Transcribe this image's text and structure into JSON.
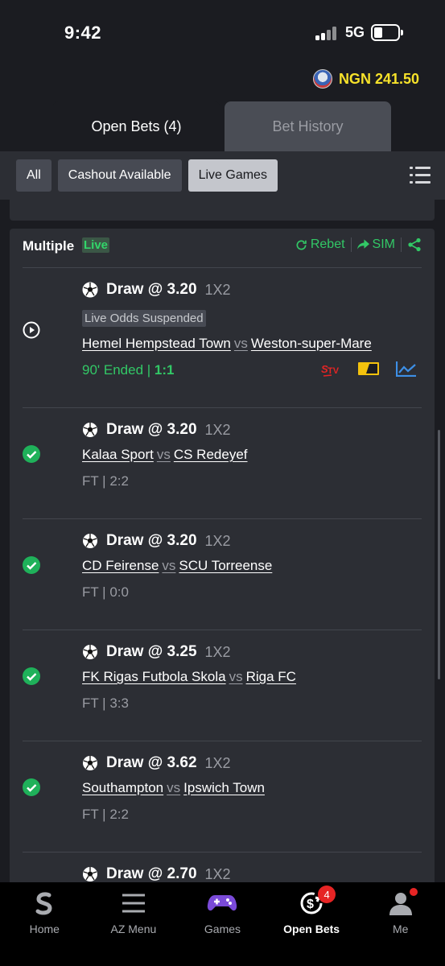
{
  "status_bar": {
    "time": "9:42",
    "network": "5G"
  },
  "account": {
    "balance": "NGN 241.50"
  },
  "tabs": [
    {
      "label": "Open Bets (4)"
    },
    {
      "label": "Bet History"
    }
  ],
  "filters": [
    {
      "label": "All"
    },
    {
      "label": "Cashout Available"
    },
    {
      "label": "Live Games"
    }
  ],
  "bet": {
    "title": "Multiple",
    "live_tag": "Live",
    "rebet_label": "Rebet",
    "sim_label": "SIM",
    "legs": [
      {
        "pick": "Draw @ 3.20",
        "market": "1X2",
        "suspended": "Live Odds Suspended",
        "home": "Hemel Hempstead Town",
        "vs": "vs",
        "away": "Weston-super-Mare",
        "status_prefix": "90' Ended | ",
        "score": "1:1",
        "state": "live"
      },
      {
        "pick": "Draw @ 3.20",
        "market": "1X2",
        "home": "Kalaa Sport",
        "vs": "vs",
        "away": "CS Redeyef",
        "result": "FT | 2:2",
        "state": "won"
      },
      {
        "pick": "Draw @ 3.20",
        "market": "1X2",
        "home": "CD Feirense",
        "vs": "vs",
        "away": "SCU Torreense",
        "result": "FT | 0:0",
        "state": "won"
      },
      {
        "pick": "Draw @ 3.25",
        "market": "1X2",
        "home": "FK Rigas Futbola Skola",
        "vs": "vs",
        "away": "Riga FC",
        "result": "FT | 3:3",
        "state": "won"
      },
      {
        "pick": "Draw @ 3.62",
        "market": "1X2",
        "home": "Southampton",
        "vs": "vs",
        "away": "Ipswich Town",
        "result": "FT | 2:2",
        "state": "won"
      },
      {
        "pick": "Draw @ 2.70",
        "market": "1X2"
      }
    ]
  },
  "bottom_nav": [
    {
      "label": "Home"
    },
    {
      "label": "AZ Menu"
    },
    {
      "label": "Games"
    },
    {
      "label": "Open Bets",
      "badge": "4"
    },
    {
      "label": "Me"
    }
  ],
  "colors": {
    "accent_green": "#32c866",
    "balance_yellow": "#f7e22a",
    "badge_red": "#e62424"
  }
}
